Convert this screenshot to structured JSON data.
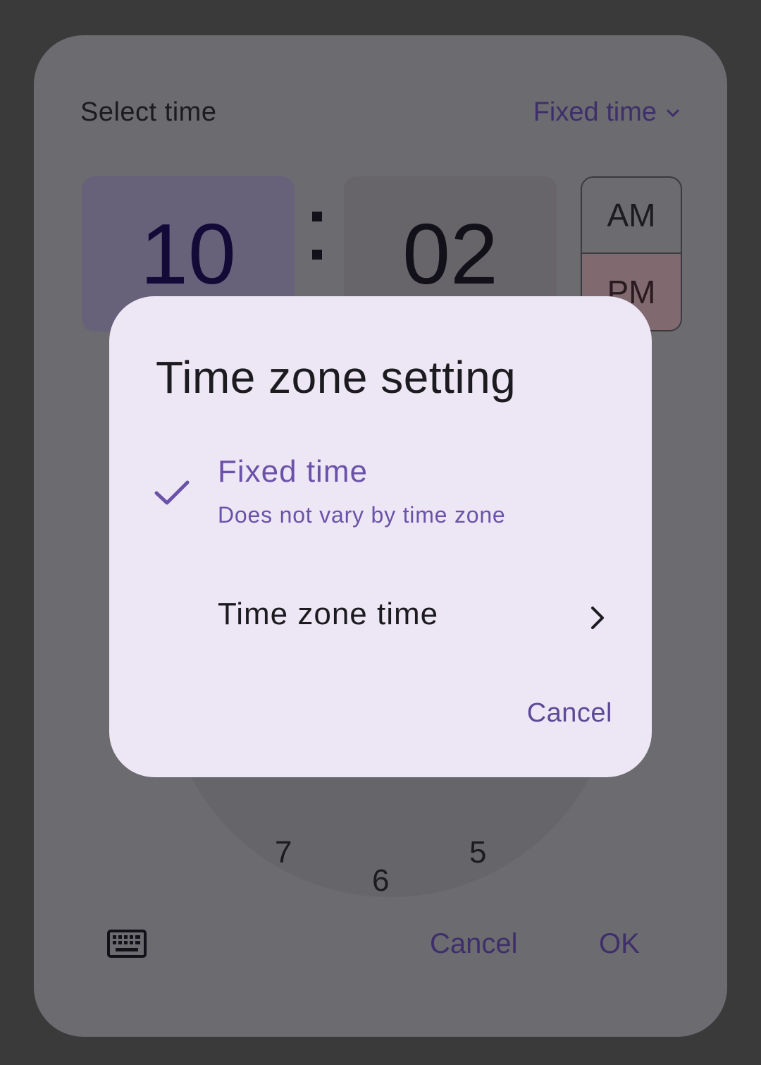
{
  "picker": {
    "title": "Select time",
    "mode_label": "Fixed time",
    "hour": "10",
    "minute": "02",
    "am_label": "AM",
    "pm_label": "PM",
    "selected_period": "PM",
    "clock_numbers": {
      "seven": "7",
      "six": "6",
      "five": "5"
    },
    "cancel_label": "Cancel",
    "ok_label": "OK",
    "keyboard_icon": "keyboard-icon"
  },
  "dialog": {
    "title": "Time zone setting",
    "options": [
      {
        "label": "Fixed time",
        "description": "Does not vary by time zone",
        "selected": true,
        "icon": "check-icon"
      },
      {
        "label": "Time zone time",
        "icon": "chevron-right-icon"
      }
    ],
    "cancel_label": "Cancel"
  },
  "colors": {
    "accent": "#6a52a8",
    "dialog_bg": "#ede7f5",
    "scrim": "#3a3a3a"
  }
}
